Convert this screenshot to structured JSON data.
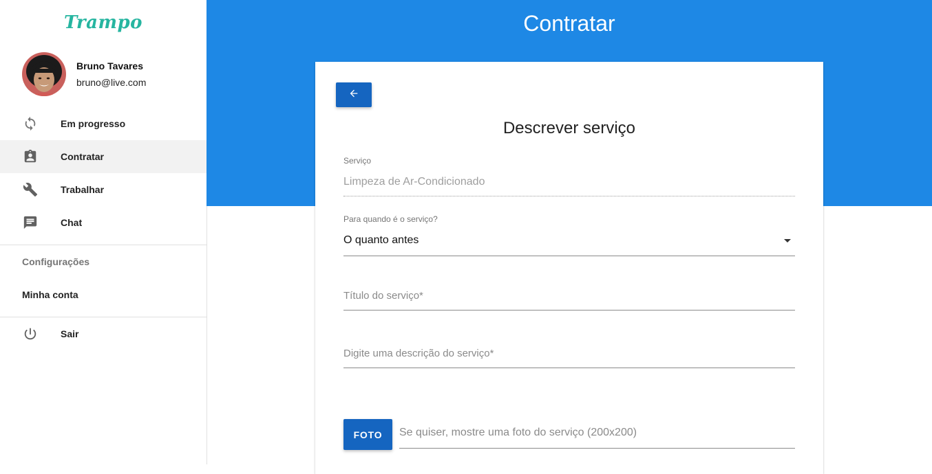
{
  "sidebar": {
    "logo": "Trampo",
    "profile": {
      "name": "Bruno Tavares",
      "email": "bruno@live.com"
    },
    "items": [
      {
        "label": "Em progresso",
        "icon": "sync-icon"
      },
      {
        "label": "Contratar",
        "icon": "assignment-ind-icon",
        "active": true
      },
      {
        "label": "Trabalhar",
        "icon": "wrench-icon"
      },
      {
        "label": "Chat",
        "icon": "chat-icon"
      }
    ],
    "settings_header": "Configurações",
    "account_label": "Minha conta",
    "logout": {
      "label": "Sair",
      "icon": "power-icon"
    }
  },
  "header": {
    "title": "Contratar"
  },
  "form": {
    "back_icon": "arrow-left-icon",
    "title": "Descrever serviço",
    "service": {
      "label": "Serviço",
      "value": "Limpeza de Ar-Condicionado"
    },
    "when": {
      "label": "Para quando é o serviço?",
      "value": "O quanto antes"
    },
    "service_title": {
      "placeholder": "Título do serviço*"
    },
    "description": {
      "placeholder": "Digite uma descrição do serviço*"
    },
    "photo": {
      "button_label": "FOTO",
      "placeholder": "Se quiser, mostre uma foto do serviço (200x200)"
    }
  },
  "colors": {
    "primary": "#1e88e5",
    "button": "#1565c0",
    "logo": "#26b5a0"
  }
}
